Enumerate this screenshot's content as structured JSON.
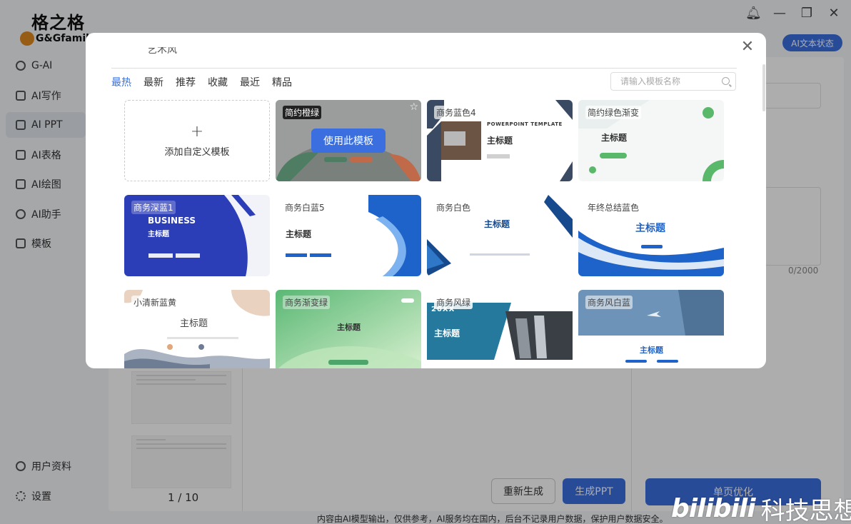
{
  "app": {
    "logo_title": "格之格",
    "logo_sub": "G&Gfamil",
    "nav": [
      {
        "label": "G-AI",
        "name": "nav-g-ai"
      },
      {
        "label": "AI写作",
        "name": "nav-ai-writing"
      },
      {
        "label": "AI PPT",
        "name": "nav-ai-ppt",
        "active": true
      },
      {
        "label": "AI表格",
        "name": "nav-ai-table"
      },
      {
        "label": "AI绘图",
        "name": "nav-ai-drawing"
      },
      {
        "label": "AI助手",
        "name": "nav-ai-assistant"
      },
      {
        "label": "模板",
        "name": "nav-templates"
      }
    ],
    "user_profile": "用户资料",
    "settings": "设置",
    "status_button": "AI文本状态",
    "page_counter": "1 / 10",
    "char_counter": "0/2000",
    "regenerate_button": "重新生成",
    "generate_button": "生成PPT",
    "single_page_button": "单页优化",
    "footer_note": "内容由AI模型输出，仅供参考，AI服务均在国内，后台不记录用户数据，保护用户数据安全。",
    "window_icons": [
      "bell-icon",
      "minimize-icon",
      "restore-icon",
      "close-icon"
    ]
  },
  "watermark": {
    "logo": "bilibili",
    "text": "科技思想"
  },
  "modal": {
    "cut_off_heading": "艺术风",
    "tabs": [
      "最热",
      "最新",
      "推荐",
      "收藏",
      "最近",
      "精品"
    ],
    "active_tab": "最热",
    "search_placeholder": "请输入模板名称",
    "add_custom_label": "添加自定义模板",
    "use_template_label": "使用此模板",
    "templates": [
      {
        "name": "简约橙绿",
        "title": ""
      },
      {
        "name": "商务蓝色4",
        "title": "主标题",
        "subtitle": "POWERPOINT TEMPLATE"
      },
      {
        "name": "简约绿色渐变",
        "title": "主标题"
      },
      {
        "name": "商务深蓝1",
        "title": "主标题",
        "subtitle": "BUSINESS"
      },
      {
        "name": "商务白蓝5",
        "title": "主标题"
      },
      {
        "name": "商务白色",
        "title": "主标题"
      },
      {
        "name": "年终总结蓝色",
        "title": "主标题"
      },
      {
        "name": "小清新蓝黄",
        "title": "主标题"
      },
      {
        "name": "商务渐变绿",
        "title": "主标题"
      },
      {
        "name": "商务风绿",
        "title": "主标题",
        "subtitle": "20XX"
      },
      {
        "name": "商务风白蓝",
        "title": "主标题"
      }
    ]
  },
  "colors": {
    "accent": "#3b6fe0",
    "overlay": "rgba(0,0,0,0.32)"
  }
}
